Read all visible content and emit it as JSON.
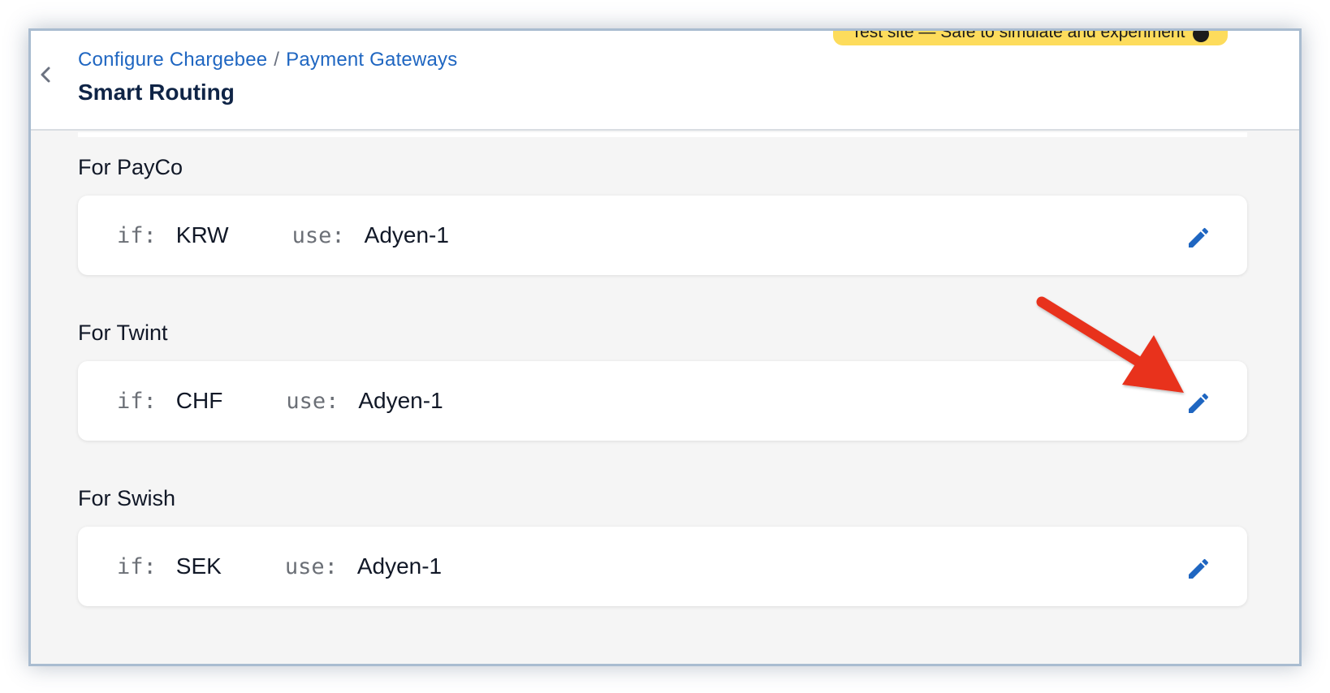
{
  "header": {
    "breadcrumb": [
      {
        "label": "Configure Chargebee"
      },
      {
        "label": "Payment Gateways"
      }
    ],
    "breadcrumb_separator": "/",
    "title": "Smart Routing",
    "test_banner": "Test site — Safe to simulate and experiment"
  },
  "routes": [
    {
      "title": "For PayCo",
      "if_label": "if:",
      "if_value": "KRW",
      "use_label": "use:",
      "use_value": "Adyen-1"
    },
    {
      "title": "For Twint",
      "if_label": "if:",
      "if_value": "CHF",
      "use_label": "use:",
      "use_value": "Adyen-1"
    },
    {
      "title": "For Swish",
      "if_label": "if:",
      "if_value": "SEK",
      "use_label": "use:",
      "use_value": "Adyen-1"
    }
  ],
  "icons": {
    "back": "chevron-left-icon",
    "edit": "pencil-icon",
    "info": "info-icon"
  },
  "colors": {
    "link": "#1f66c1",
    "title": "#0f2446",
    "banner": "#fddc5c",
    "edit_icon": "#1f66c1",
    "annotation_arrow": "#e8321e"
  }
}
